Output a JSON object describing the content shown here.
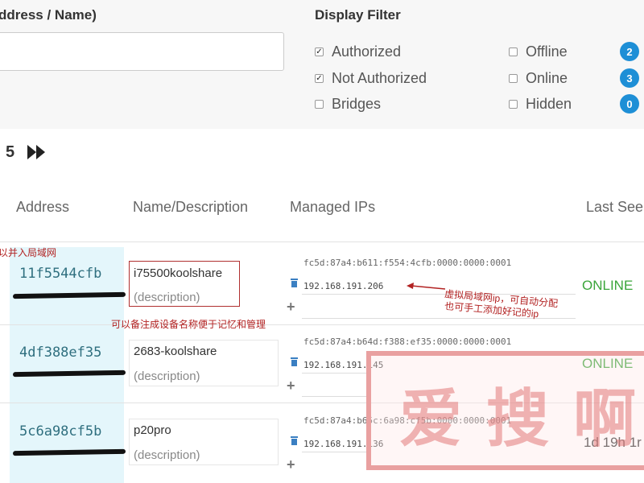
{
  "header": {
    "search_label": "ddress / Name)",
    "search_value": "",
    "filter_label": "Display Filter"
  },
  "filters": {
    "authorized": {
      "label": "Authorized",
      "checked": true
    },
    "not_authorized": {
      "label": "Not Authorized",
      "checked": true
    },
    "bridges": {
      "label": "Bridges",
      "checked": false
    },
    "offline": {
      "label": "Offline",
      "checked": false,
      "count": "2"
    },
    "online": {
      "label": "Online",
      "checked": false,
      "count": "3"
    },
    "hidden": {
      "label": "Hidden",
      "checked": false,
      "count": "0"
    }
  },
  "pager": {
    "page": "5",
    "next_icon": "fast-forward-icon"
  },
  "columns": {
    "address": "Address",
    "name": "Name/Description",
    "managed_ips": "Managed IPs",
    "last_seen": "Last See"
  },
  "annotations": {
    "join_lan": "以并入局域网",
    "name_note": "可以备注成设备名称便于记忆和管理",
    "ip_note_line1": "虚拟局域网ip，可自动分配",
    "ip_note_line2": "也可手工添加好记的ip",
    "watermark": "爱搜啊"
  },
  "members": [
    {
      "id": "11f5544cfb",
      "name": "i75500koolshare",
      "description": "(description)",
      "ipv6": "fc5d:87a4:b611:f554:4cfb:0000:0000:0001",
      "ipv4": "192.168.191.206",
      "status": "ONLINE"
    },
    {
      "id": "4df388ef35",
      "name": "2683-koolshare",
      "description": "(description)",
      "ipv6": "fc5d:87a4:b64d:f388:ef35:0000:0000:0001",
      "ipv4": "192.168.191.145",
      "status": "ONLINE"
    },
    {
      "id": "5c6a98cf5b",
      "name": "p20pro",
      "description": "(description)",
      "ipv6": "fc5d:87a4:b65c:6a98:cf5b:0000:0000:0001",
      "ipv4": "192.168.191.136",
      "status": "1d 19h 1r"
    }
  ],
  "colors": {
    "accent": "#1e8fd6",
    "online": "#3aa53a",
    "annotation": "#b22222",
    "address_bg": "#e4f6fb"
  },
  "icons": {
    "checkbox_checked": "check-icon",
    "trash": "trash-icon",
    "add": "plus-icon"
  }
}
